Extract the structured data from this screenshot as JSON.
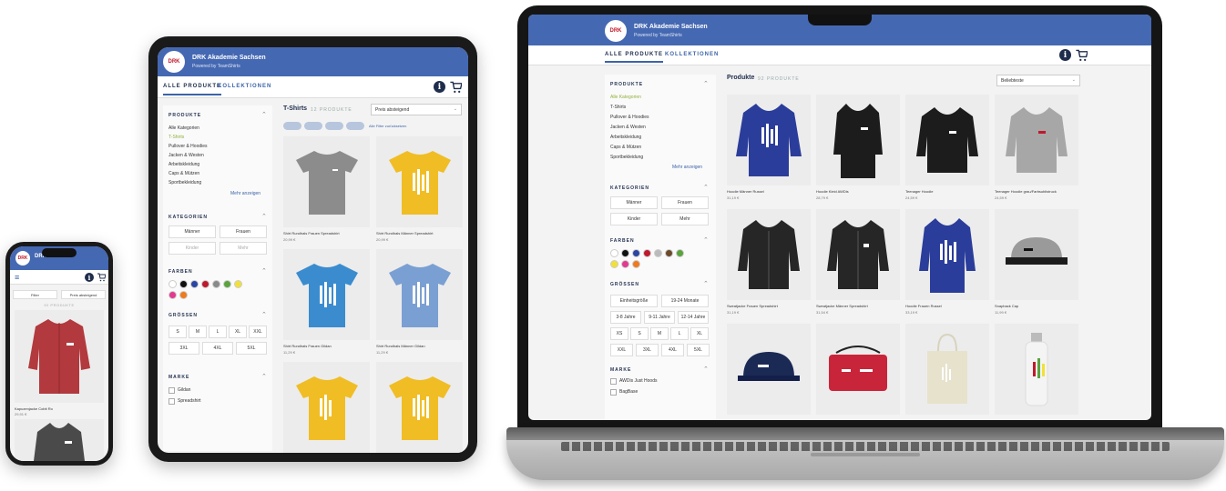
{
  "shop": {
    "brand_title": "DRK Akademie Sachsen",
    "brand_sub": "Powered by TeamShirts",
    "tabs": [
      "ALLE PRODUKTE",
      "KOLLEKTIONEN"
    ],
    "info_icon": "i",
    "sections": {
      "produkte": "PRODUKTE",
      "kategorien": "KATEGORIEN",
      "farben": "FARBEN",
      "groessen": "GRÖSSEN",
      "marke": "MARKE"
    },
    "categories": [
      "Alle Kategorien",
      "T-Shirts",
      "Pullover & Hoodies",
      "Jacken & Westen",
      "Arbeitskleidung",
      "Caps & Mützen",
      "Sportbekleidung"
    ],
    "more_label": "Mehr anzeigen",
    "kategorien_buttons": [
      "Männer",
      "Frauen",
      "Kinder",
      "Mehr"
    ],
    "sizes": [
      "Einheitsgröße",
      "19-24 Monate",
      "3-8 Jahre",
      "9-11 Jahre",
      "12-14 Jahre",
      "XS",
      "S",
      "M",
      "L",
      "XL",
      "XXL",
      "3XL",
      "4XL",
      "5XL"
    ],
    "brands_laptop": [
      "AWDis Just Hoods",
      "BagBase"
    ],
    "brands_tablet": [
      "Gildan",
      "Spreadshirt"
    ]
  },
  "laptop": {
    "heading": "Produkte",
    "count": "92 PRODUKTE",
    "sort": "Beliebteste",
    "products": [
      {
        "name": "Hoodie Männer Russel",
        "price": "31,19 €"
      },
      {
        "name": "Hoodie Kleid AWDis",
        "price": "28,79 €"
      },
      {
        "name": "Teenager Hoodie",
        "price": "24,59 €"
      },
      {
        "name": "Teenager Hoodie grau/Farbsublistruck",
        "price": "24,59 €"
      },
      {
        "name": "Sweatjacke Frauen Spreadshirt",
        "price": "31,19 €"
      },
      {
        "name": "Sweatjacke Männer Spreadshirt",
        "price": "31,54 €"
      },
      {
        "name": "Hoodie Frauen Russel",
        "price": "33,19 €"
      },
      {
        "name": "Snapback Cap",
        "price": "11,99 €"
      }
    ]
  },
  "tablet": {
    "heading": "T-Shirts",
    "count": "12 PRODUKTE",
    "sort": "Preis absteigend",
    "reset": "Alle Filter zurücksetzen",
    "products": [
      {
        "name": "Shirt Rundhals Frauen Spreadshirt",
        "price": "20,99 €"
      },
      {
        "name": "Shirt Rundhals Männer Spreadshirt",
        "price": "20,99 €"
      },
      {
        "name": "Shirt Rundhals Frauen Gildan",
        "price": "11,29 €"
      },
      {
        "name": "Shirt Rundhals Männer Gildan",
        "price": "11,29 €"
      }
    ]
  },
  "phone": {
    "brand_title": "DRK",
    "filter": "Filter",
    "sort": "Preis absteigend",
    "count": "92 PRODUKTE",
    "product_name": "Kapuzenjacke Cobit Ro",
    "product_price": "29,91 €"
  },
  "colors": {
    "brand_blue": "#4568b2",
    "navy": "#1f2d4d",
    "accent_green": "#8fb23a",
    "drk_red": "#c0192c"
  }
}
